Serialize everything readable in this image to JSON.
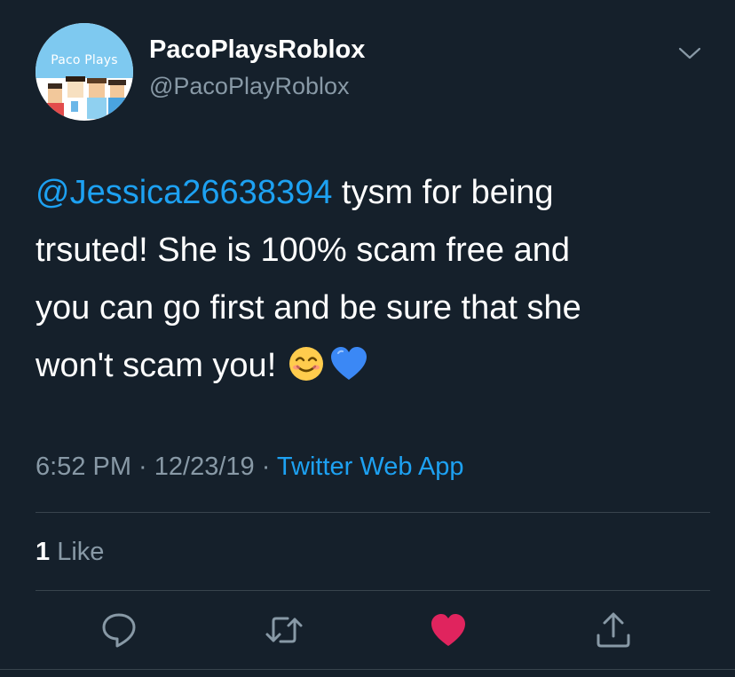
{
  "avatar": {
    "text": "Paco Plays"
  },
  "author": {
    "display_name": "PacoPlaysRoblox",
    "handle": "@PacoPlayRoblox"
  },
  "tweet": {
    "mention": "@Jessica26638394",
    "body_line1": " tysm for being",
    "body_line2": "trsuted! She is 100% scam free and",
    "body_line3": "you can go first and be sure that she",
    "body_line4": "won't scam you!"
  },
  "meta": {
    "time": "6:52 PM",
    "sep1": " · ",
    "date": "12/23/19",
    "sep2": " · ",
    "source": "Twitter Web App"
  },
  "stats": {
    "like_count": "1",
    "like_label": " Like"
  },
  "icons": {
    "menu": "chevron-down-icon",
    "emoji_1": "smiling-face-icon",
    "emoji_2": "blue-heart-icon",
    "reply": "reply-icon",
    "retweet": "retweet-icon",
    "like": "heart-icon",
    "share": "share-icon"
  },
  "colors": {
    "background": "#15202b",
    "link": "#1da1f2",
    "secondary_text": "#8899a6",
    "like_active": "#e0245e",
    "divider": "#38444d"
  }
}
